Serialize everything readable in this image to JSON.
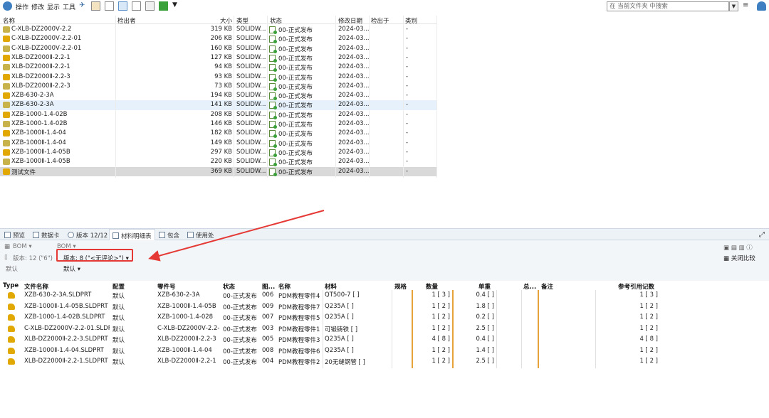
{
  "toolbar": {
    "menus": [
      "操作",
      "修改",
      "显示",
      "工具"
    ],
    "search_placeholder": "在 当前文件夹 中搜索"
  },
  "file_list": {
    "columns": [
      "名称",
      "检出者",
      "大小",
      "类型",
      "状态",
      "修改日期",
      "检出于",
      "类别"
    ],
    "rows": [
      {
        "name": "C-XLB-DZ2000Ⅴ-2.2",
        "size": "319 KB",
        "type": "SOLIDW...",
        "status": "00-正式发布",
        "date": "2024-03...",
        "cat": "-"
      },
      {
        "name": "C-XLB-DZ2000Ⅴ-2.2-01",
        "size": "206 KB",
        "type": "SOLIDW...",
        "status": "00-正式发布",
        "date": "2024-03...",
        "cat": "-"
      },
      {
        "name": "C-XLB-DZ2000Ⅴ-2.2-01",
        "size": "160 KB",
        "type": "SOLIDW...",
        "status": "00-正式发布",
        "date": "2024-03...",
        "cat": "-"
      },
      {
        "name": "XLB-DZ2000Ⅱ-2.2-1",
        "size": "127 KB",
        "type": "SOLIDW...",
        "status": "00-正式发布",
        "date": "2024-03...",
        "cat": "-"
      },
      {
        "name": "XLB-DZ2000Ⅱ-2.2-1",
        "size": "94 KB",
        "type": "SOLIDW...",
        "status": "00-正式发布",
        "date": "2024-03...",
        "cat": "-"
      },
      {
        "name": "XLB-DZ2000Ⅱ-2.2-3",
        "size": "93 KB",
        "type": "SOLIDW...",
        "status": "00-正式发布",
        "date": "2024-03...",
        "cat": "-"
      },
      {
        "name": "XLB-DZ2000Ⅱ-2.2-3",
        "size": "73 KB",
        "type": "SOLIDW...",
        "status": "00-正式发布",
        "date": "2024-03...",
        "cat": "-"
      },
      {
        "name": "XZB-630-2-3A",
        "size": "194 KB",
        "type": "SOLIDW...",
        "status": "00-正式发布",
        "date": "2024-03...",
        "cat": "-"
      },
      {
        "name": "XZB-630-2-3A",
        "size": "141 KB",
        "type": "SOLIDW...",
        "status": "00-正式发布",
        "date": "2024-03...",
        "cat": "-"
      },
      {
        "name": "XZB-1000-1.4-02B",
        "size": "208 KB",
        "type": "SOLIDW...",
        "status": "00-正式发布",
        "date": "2024-03...",
        "cat": "-"
      },
      {
        "name": "XZB-1000-1.4-02B",
        "size": "146 KB",
        "type": "SOLIDW...",
        "status": "00-正式发布",
        "date": "2024-03...",
        "cat": "-"
      },
      {
        "name": "XZB-1000Ⅱ-1.4-04",
        "size": "182 KB",
        "type": "SOLIDW...",
        "status": "00-正式发布",
        "date": "2024-03...",
        "cat": "-"
      },
      {
        "name": "XZB-1000Ⅱ-1.4-04",
        "size": "149 KB",
        "type": "SOLIDW...",
        "status": "00-正式发布",
        "date": "2024-03...",
        "cat": "-"
      },
      {
        "name": "XZB-1000Ⅱ-1.4-05B",
        "size": "297 KB",
        "type": "SOLIDW...",
        "status": "00-正式发布",
        "date": "2024-03...",
        "cat": "-"
      },
      {
        "name": "XZB-1000Ⅱ-1.4-05B",
        "size": "220 KB",
        "type": "SOLIDW...",
        "status": "00-正式发布",
        "date": "2024-03...",
        "cat": "-"
      },
      {
        "name": "测试文件",
        "size": "369 KB",
        "type": "SOLIDW...",
        "status": "00-正式发布",
        "date": "2024-03...",
        "cat": "-"
      }
    ]
  },
  "tabs": [
    {
      "label": "预览"
    },
    {
      "label": "数据卡"
    },
    {
      "label": "版本 12/12"
    },
    {
      "label": "材料明细表"
    },
    {
      "label": "包含"
    },
    {
      "label": "使用处"
    }
  ],
  "bom_panel": {
    "bom_label": "BOM",
    "version_left": "版本: 12 (\"6\")",
    "config_left": "默认",
    "version_select": "版本: 8 (\"<无评论>\")",
    "config_select": "默认",
    "close_compare": "关闭比较"
  },
  "bom_table": {
    "headers": [
      "Type",
      "文件名称",
      "配置",
      "零件号",
      "状态",
      "图...",
      "名称",
      "材料",
      "规格",
      "数量",
      "单重",
      "总...",
      "备注",
      "参考引用记数"
    ],
    "rows": [
      {
        "file": "XZB-630-2-3A.SLDPRT",
        "config": "默认",
        "part": "XZB-630-2-3A",
        "status": "00-正式发布",
        "fig": "006",
        "name": "PDM教程零件4",
        "material": "QT500-7 [ ]",
        "spec": "",
        "qty": "1 [ 3 ]",
        "weight": "0.4 [ ]",
        "ref": "1 [ 3 ]"
      },
      {
        "file": "XZB-1000Ⅱ-1.4-05B.SLDPRT",
        "config": "默认",
        "part": "XZB-1000Ⅱ-1.4-05B",
        "status": "00-正式发布",
        "fig": "009",
        "name": "PDM教程零件7",
        "material": "Q235A [ ]",
        "spec": "",
        "qty": "1 [ 2 ]",
        "weight": "1.8 [ ]",
        "ref": "1 [ 2 ]"
      },
      {
        "file": "XZB-1000-1.4-02B.SLDPRT",
        "config": "默认",
        "part": "XZB-1000-1.4-028",
        "status": "00-正式发布",
        "fig": "007",
        "name": "PDM教程零件5",
        "material": "Q235A [ ]",
        "spec": "",
        "qty": "1 [ 2 ]",
        "weight": "0.2 [ ]",
        "ref": "1 [ 2 ]"
      },
      {
        "file": "C-XLB-DZ2000Ⅴ-2.2-01.SLDP...",
        "config": "默认",
        "part": "C-XLB-DZ2000Ⅴ-2.2-...",
        "status": "00-正式发布",
        "fig": "003",
        "name": "PDM教程零件1",
        "material": "可锻铸铁 [ ]",
        "spec": "",
        "qty": "1 [ 2 ]",
        "weight": "2.5 [ ]",
        "ref": "1 [ 2 ]"
      },
      {
        "file": "XLB-DZ2000Ⅱ-2.2-3.SLDPRT",
        "config": "默认",
        "part": "XLB-DZ2000Ⅱ-2.2-3",
        "status": "00-正式发布",
        "fig": "005",
        "name": "PDM教程零件3",
        "material": "Q235A [ ]",
        "spec": "",
        "qty": "4 [ 8 ]",
        "weight": "0.4 [ ]",
        "ref": "4 [ 8 ]"
      },
      {
        "file": "XZB-1000Ⅱ-1.4-04.SLDPRT",
        "config": "默认",
        "part": "XZB-1000Ⅱ-1.4-04",
        "status": "00-正式发布",
        "fig": "008",
        "name": "PDM教程零件6",
        "material": "Q235A [ ]",
        "spec": "",
        "qty": "1 [ 2 ]",
        "weight": "1.4 [ ]",
        "ref": "1 [ 2 ]"
      },
      {
        "file": "XLB-DZ2000Ⅱ-2.2-1.SLDPRT",
        "config": "默认",
        "part": "XLB-DZ2000Ⅱ-2.2-1",
        "status": "00-正式发布",
        "fig": "004",
        "name": "PDM教程零件2",
        "material": "20无缝钢管 [ ]",
        "spec": "",
        "qty": "1 [ 2 ]",
        "weight": "2.5 [ ]",
        "ref": "1 [ 2 ]"
      }
    ]
  },
  "colors": {
    "assembly_icon": "#e0a800",
    "part_icon": "#c8b24a",
    "highlight_red": "#e53935",
    "orange_divider": "#e8a23a",
    "selected_row": "#e6f1fb",
    "gray_row": "#d9d9d9"
  }
}
